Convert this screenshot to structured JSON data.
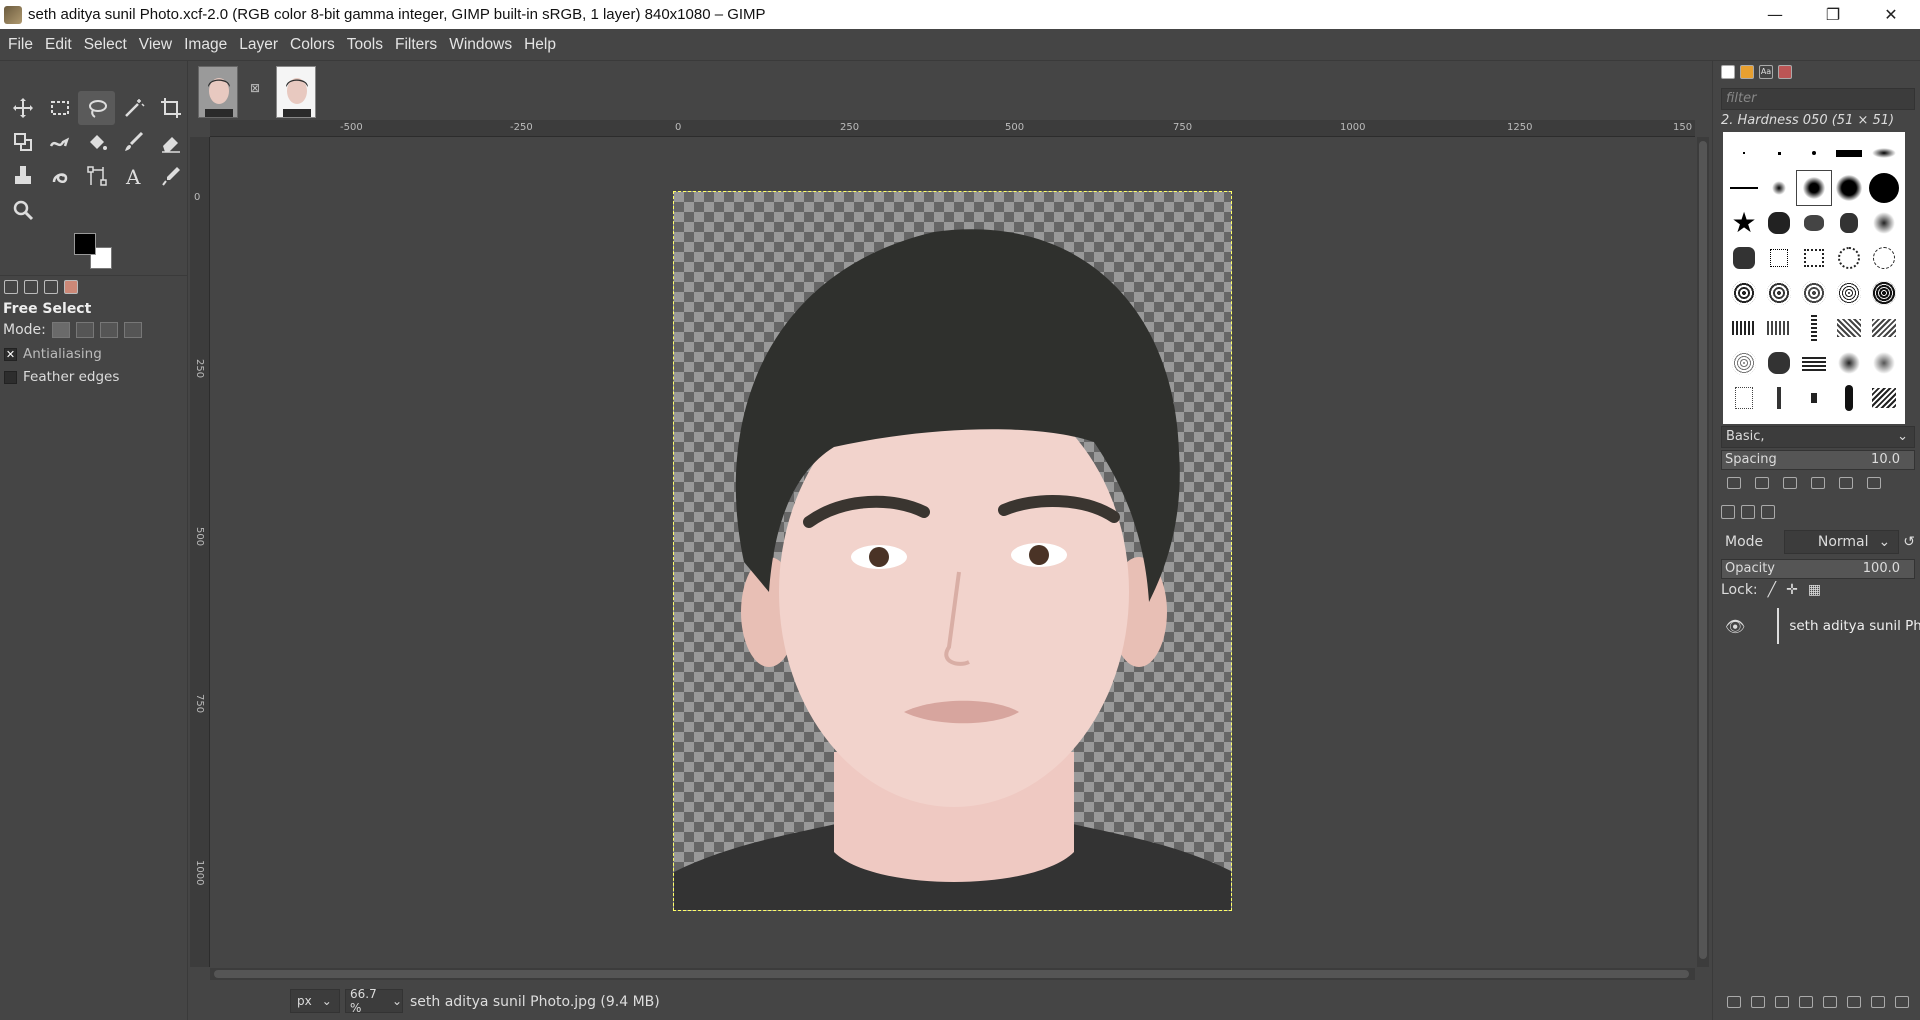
{
  "window": {
    "title": "seth aditya sunil Photo.xcf-2.0 (RGB color 8-bit gamma integer, GIMP built-in sRGB, 1 layer) 840x1080 – GIMP",
    "minimize": "—",
    "maximize": "❐",
    "close": "✕"
  },
  "menubar": [
    "File",
    "Edit",
    "Select",
    "View",
    "Image",
    "Layer",
    "Colors",
    "Tools",
    "Filters",
    "Windows",
    "Help"
  ],
  "tools": [
    "move-icon",
    "rect-select-icon",
    "free-select-icon",
    "fuzzy-select-icon",
    "crop-icon",
    "unified-transform-icon",
    "warp-icon",
    "bucket-fill-icon",
    "paintbrush-icon",
    "eraser-icon",
    "clone-icon",
    "smudge-icon",
    "paths-icon",
    "text-icon",
    "color-picker-icon",
    "zoom-icon"
  ],
  "tool_options": {
    "title": "Free Select",
    "mode_label": "Mode:",
    "antialiasing_label": "Antialiasing",
    "antialiasing_checked": true,
    "feather_label": "Feather edges",
    "feather_checked": false
  },
  "rulers": {
    "h_labels": [
      "-500",
      "-250",
      "0",
      "250",
      "500",
      "750",
      "1000",
      "1250",
      "150"
    ],
    "v_labels": [
      "0",
      "250",
      "500",
      "750",
      "1000"
    ]
  },
  "statusbar": {
    "unit": "px",
    "zoom": "66.7 %",
    "message": "seth aditya sunil Photo.jpg (9.4 MB)"
  },
  "brushes": {
    "filter_placeholder": "filter",
    "selected_name": "2. Hardness 050 (51 × 51)",
    "tag_select": "Basic,",
    "spacing_label": "Spacing",
    "spacing_value": "10.0"
  },
  "layers": {
    "mode_label": "Mode",
    "mode_value": "Normal",
    "opacity_label": "Opacity",
    "opacity_value": "100.0",
    "lock_label": "Lock:",
    "items": [
      {
        "name": "seth aditya sunil Photo.jpg",
        "visible": true
      }
    ]
  },
  "colors": {
    "foreground": "#000000",
    "background": "#ffffff",
    "selection": "#ffff66"
  }
}
